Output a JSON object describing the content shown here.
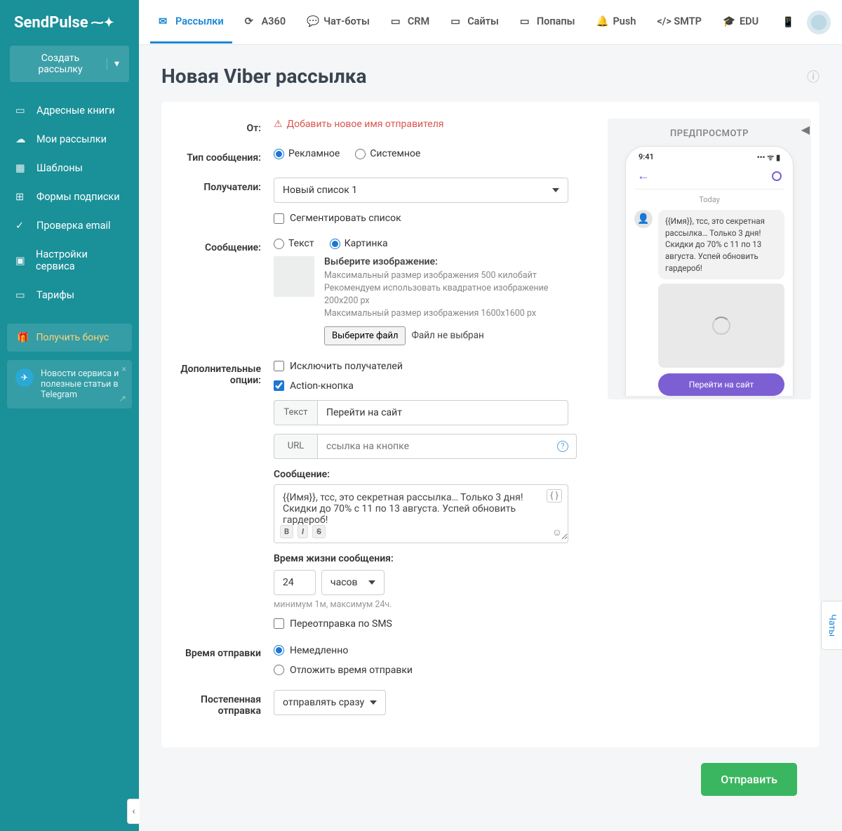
{
  "logo": "SendPulse",
  "sidebar": {
    "create": "Создать рассылку",
    "items": [
      {
        "label": "Адресные книги"
      },
      {
        "label": "Мои рассылки"
      },
      {
        "label": "Шаблоны"
      },
      {
        "label": "Формы подписки"
      },
      {
        "label": "Проверка email"
      },
      {
        "label": "Настройки сервиса"
      },
      {
        "label": "Тарифы"
      }
    ],
    "bonus": "Получить бонус",
    "telegram": "Новости сервиса и полезные статьи в Telegram"
  },
  "topnav": {
    "tabs": [
      {
        "label": "Рассылки"
      },
      {
        "label": "A360"
      },
      {
        "label": "Чат-боты"
      },
      {
        "label": "CRM"
      },
      {
        "label": "Сайты"
      },
      {
        "label": "Попапы"
      },
      {
        "label": "Push"
      },
      {
        "label": "SMTP"
      },
      {
        "label": "EDU"
      }
    ]
  },
  "page": {
    "title": "Новая Viber рассылка"
  },
  "form": {
    "from_label": "От:",
    "from_warn": "Добавить новое имя отправителя",
    "type_label": "Тип сообщения:",
    "type_ad": "Рекламное",
    "type_sys": "Системное",
    "recipients_label": "Получатели:",
    "recipients_value": "Новый список 1",
    "segment": "Сегментировать список",
    "message_label": "Сообщение:",
    "msg_text": "Текст",
    "msg_image": "Картинка",
    "img_title": "Выберите изображение:",
    "img_hint1": "Максимальный размер изображения 500 килобайт",
    "img_hint2": "Рекомендуем использовать квадратное изображение 200x200 px",
    "img_hint3": "Максимальный размер изображения 1600x1600 px",
    "file_btn": "Выберите файл",
    "file_status": "Файл не выбран",
    "addopts_label": "Дополнительные опции:",
    "exclude": "Исключить получателей",
    "action_btn": "Action-кнопка",
    "btn_text_label": "Текст",
    "btn_text_value": "Перейти на сайт",
    "btn_url_label": "URL",
    "btn_url_placeholder": "ссылка на кнопке",
    "msg_box_label": "Сообщение:",
    "msg_box_value": "{{Имя}}, тсс, это секретная рассылка… Только 3 дня! Скидки до 70% с 11 по 13 августа. Успей обновить гардероб!",
    "ttl_label": "Время жизни сообщения:",
    "ttl_value": "24",
    "ttl_unit": "часов",
    "ttl_hint": "минимум 1м, максимум 24ч.",
    "resend_sms": "Переотправка по SMS",
    "sendtime_label": "Время отправки",
    "send_now": "Немедленно",
    "send_later": "Отложить время отправки",
    "gradual_label": "Постепенная отправка",
    "gradual_value": "отправлять сразу"
  },
  "preview": {
    "title": "ПРЕДПРОСМОТР",
    "time": "9:41",
    "today": "Today",
    "message": "{{Имя}}, тсс, это секретная рассылка… Только 3 дня! Скидки до 70% с 11 по 13 августа. Успей обновить гардероб!",
    "action": "Перейти на сайт"
  },
  "footer": {
    "send": "Отправить"
  },
  "chat_tab": "Чаты"
}
